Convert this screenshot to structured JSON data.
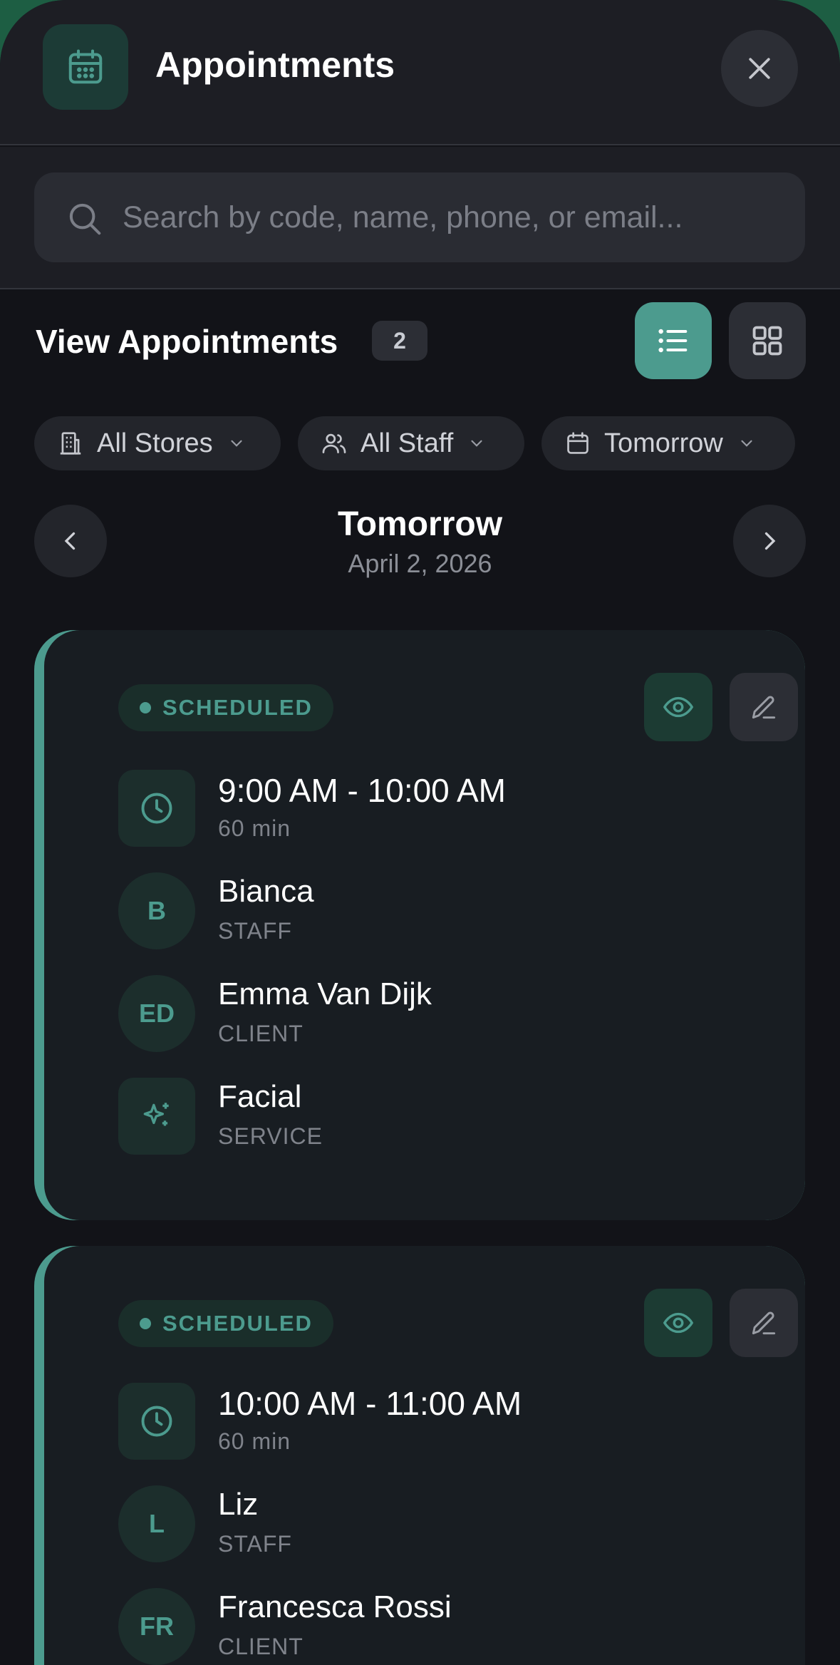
{
  "header": {
    "title": "Appointments",
    "icon": "calendar-icon",
    "close_icon": "close-icon"
  },
  "search": {
    "placeholder": "Search by code, name, phone, or email...",
    "value": ""
  },
  "toolbar": {
    "label": "View Appointments",
    "count": "2",
    "list_view_active": true
  },
  "filters": {
    "stores": "All Stores",
    "staff": "All Staff",
    "date": "Tomorrow"
  },
  "date_nav": {
    "title": "Tomorrow",
    "subtitle": "April 2, 2026"
  },
  "appointments": [
    {
      "status": "SCHEDULED",
      "time": "9:00 AM - 10:00 AM",
      "duration": "60 min",
      "staff_initial": "B",
      "staff": "Bianca",
      "staff_label": "STAFF",
      "client_initials": "ED",
      "client": "Emma Van Dijk",
      "client_label": "CLIENT",
      "service": "Facial",
      "service_label": "SERVICE"
    },
    {
      "status": "SCHEDULED",
      "time": "10:00 AM - 11:00 AM",
      "duration": "60 min",
      "staff_initial": "L",
      "staff": "Liz",
      "staff_label": "STAFF",
      "client_initials": "FR",
      "client": "Francesca Rossi",
      "client_label": "CLIENT"
    }
  ],
  "colors": {
    "accent": "#4c9b8e",
    "background": "#121318",
    "card": "#181d22",
    "brand_green": "#1d5e43"
  }
}
